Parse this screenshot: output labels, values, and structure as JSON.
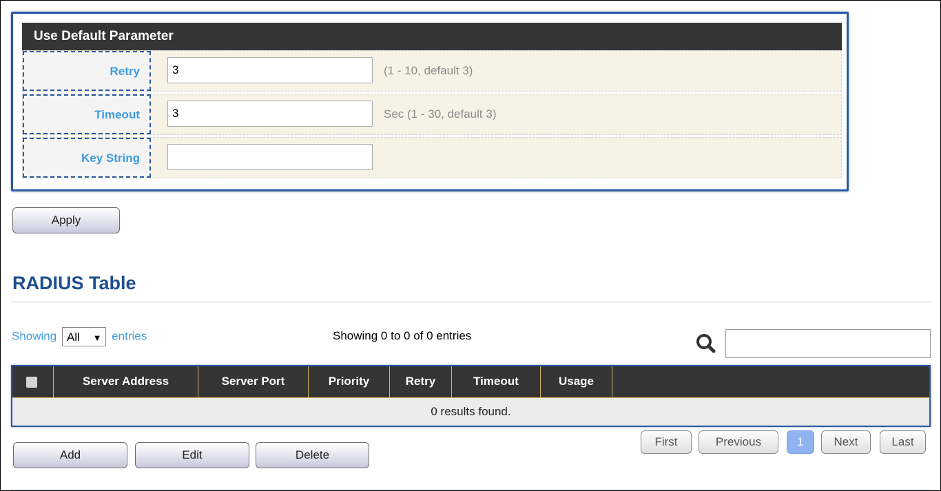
{
  "panel": {
    "title": "Use Default Parameter",
    "rows": [
      {
        "label": "Retry",
        "value": "3",
        "hint": "(1 - 10, default 3)"
      },
      {
        "label": "Timeout",
        "value": "3",
        "hint": "Sec (1 - 30, default 3)"
      },
      {
        "label": "Key String",
        "value": "",
        "hint": ""
      }
    ]
  },
  "apply_label": "Apply",
  "table_section": {
    "title": "RADIUS Table",
    "showing_prefix": "Showing",
    "entries_select": "All",
    "showing_suffix": "entries",
    "info": "Showing 0 to 0 of 0 entries",
    "search_placeholder": "",
    "columns": [
      "Server Address",
      "Server Port",
      "Priority",
      "Retry",
      "Timeout",
      "Usage"
    ],
    "empty_text": "0 results found."
  },
  "actions": {
    "add": "Add",
    "edit": "Edit",
    "delete": "Delete"
  },
  "pagination": {
    "first": "First",
    "previous": "Previous",
    "current": "1",
    "next": "Next",
    "last": "Last"
  },
  "colors": {
    "accent": "#2a5aa0",
    "label": "#3c9be0",
    "title": "#1e4f8f",
    "header_bg": "#353535",
    "row_bg": "#f6f3e6"
  },
  "icons": {
    "search": "search-icon",
    "select_caret": "triangle-down-icon"
  }
}
